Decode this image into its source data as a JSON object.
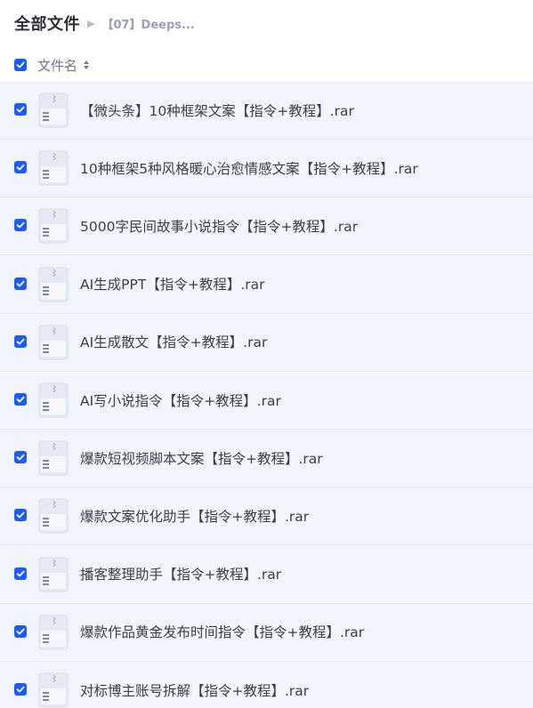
{
  "breadcrumb": {
    "root": "全部文件",
    "current": "【07】Deeps..."
  },
  "header": {
    "name_label": "文件名"
  },
  "colors": {
    "checkbox": "#1a5cff",
    "rows_bg": "#f3f5fc"
  },
  "files": [
    {
      "name": "【微头条】10种框架文案【指令+教程】.rar",
      "checked": true,
      "icon": "archive-file-icon"
    },
    {
      "name": "10种框架5种风格暖心治愈情感文案【指令+教程】.rar",
      "checked": true,
      "icon": "archive-file-icon"
    },
    {
      "name": "5000字民间故事小说指令【指令+教程】.rar",
      "checked": true,
      "icon": "archive-file-icon"
    },
    {
      "name": "AI生成PPT【指令+教程】.rar",
      "checked": true,
      "icon": "archive-file-icon"
    },
    {
      "name": "AI生成散文【指令+教程】.rar",
      "checked": true,
      "icon": "archive-file-icon"
    },
    {
      "name": "AI写小说指令【指令+教程】.rar",
      "checked": true,
      "icon": "archive-file-icon"
    },
    {
      "name": "爆款短视频脚本文案【指令+教程】.rar",
      "checked": true,
      "icon": "archive-file-icon"
    },
    {
      "name": "爆款文案优化助手【指令+教程】.rar",
      "checked": true,
      "icon": "archive-file-icon"
    },
    {
      "name": "播客整理助手【指令+教程】.rar",
      "checked": true,
      "icon": "archive-file-icon"
    },
    {
      "name": "爆款作品黄金发布时间指令【指令+教程】.rar",
      "checked": true,
      "icon": "archive-file-icon"
    },
    {
      "name": "对标博主账号拆解【指令+教程】.rar",
      "checked": true,
      "icon": "archive-file-icon"
    }
  ]
}
